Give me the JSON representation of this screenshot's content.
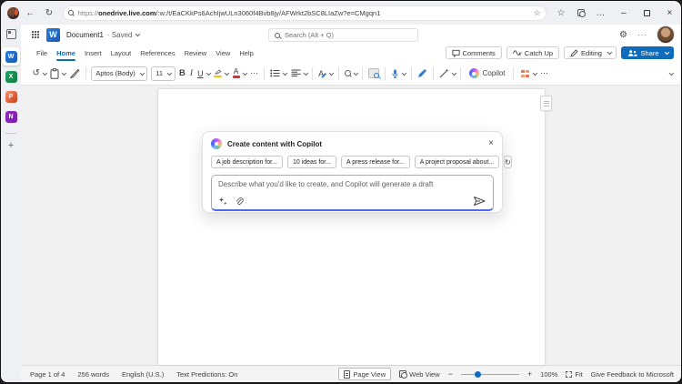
{
  "browser": {
    "url_scheme": "https://",
    "url_domain": "onedrive.live.com",
    "url_path": "/:w:/t/EaCKkPs6AchIjwULn3060f4Bvb8jy/AFWrkt2bSC8LIaZw?e=CMgqn1"
  },
  "icons": {
    "back": "←",
    "browser_refresh": "↻",
    "star": "☆",
    "browser_more": "…",
    "minimize": "–",
    "close": "×",
    "gear": "⚙",
    "header_more": "···",
    "undo": "↺",
    "toolbar_more": "⋯",
    "dialog_close": "×",
    "dialog_refresh": "↻",
    "zoom_out": "−",
    "zoom_in": "+",
    "sidebar_add": "+"
  },
  "sidebar": {
    "word_letter": "W",
    "excel_letter": "X",
    "powerpoint_letter": "P",
    "onenote_letter": "N"
  },
  "header": {
    "doc_title": "Document1",
    "save_status": "· Saved",
    "search_placeholder": "Search (Alt + Q)"
  },
  "ribbon": {
    "tabs": [
      "File",
      "Home",
      "Insert",
      "Layout",
      "References",
      "Review",
      "View",
      "Help"
    ],
    "active_tab": "Home",
    "comments": "Comments",
    "catch_up": "Catch Up",
    "editing": "Editing",
    "share": "Share"
  },
  "toolbar": {
    "font_name": "Aptos (Body)",
    "font_size": "11",
    "bold": "B",
    "italic": "I",
    "underline": "U",
    "font_color_letter": "A",
    "styles_letter": "A",
    "copilot": "Copilot"
  },
  "copilot_dialog": {
    "title": "Create content with Copilot",
    "suggestions": [
      "A job description for...",
      "10 ideas for...",
      "A press release for...",
      "A project proposal about..."
    ],
    "input_placeholder": "Describe what you'd like to create, and Copilot will generate a draft"
  },
  "status_bar": {
    "items": [
      "Page 1 of 4",
      "256 words",
      "English (U.S.)",
      "Text Predictions: On"
    ],
    "page_view": "Page View",
    "web_view": "Web View",
    "zoom_level": "100%",
    "fit": "Fit",
    "feedback": "Give Feedback to Microsoft"
  },
  "colors": {
    "accent": "#0f6cbd",
    "share_button": "#0f6cbd",
    "copilot_input_focus": "#4f6bed",
    "highlight_yellow": "#f3c300",
    "font_color_red": "#d13438"
  }
}
